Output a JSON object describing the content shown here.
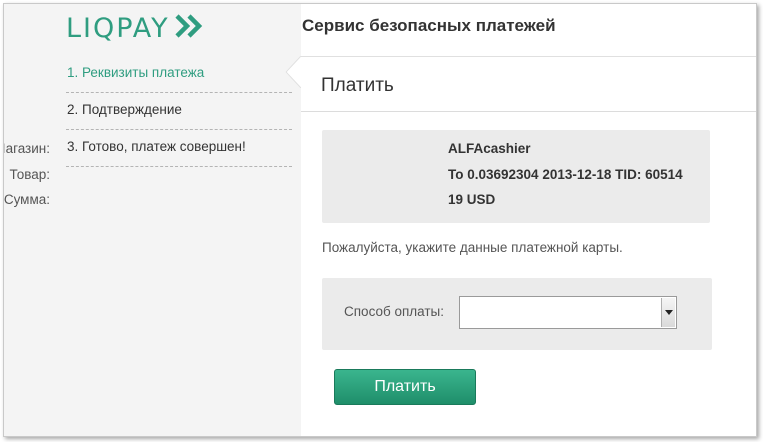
{
  "brand": {
    "logo_text": "LIQPAY",
    "accent_color": "#2f9d80"
  },
  "header": {
    "title": "Сервис безопасных платежей"
  },
  "sidebar": {
    "steps": [
      {
        "label": "1. Реквизиты платежа",
        "active": true
      },
      {
        "label": "2. Подтверждение",
        "active": false
      },
      {
        "label": "3. Готово, платеж совершен!",
        "active": false
      }
    ]
  },
  "main": {
    "title": "Платить",
    "details": [
      {
        "label": "Магазин:",
        "value": "ALFAcashier"
      },
      {
        "label": "Товар:",
        "value": "To 0.03692304 2013-12-18 TID: 60514"
      },
      {
        "label": "Сумма:",
        "value": "19 USD"
      }
    ],
    "prompt": "Пожалуйста, укажите данные платежной карты.",
    "payment_method": {
      "label": "Способ оплаты:",
      "selected": ""
    },
    "pay_button_label": "Платить"
  }
}
